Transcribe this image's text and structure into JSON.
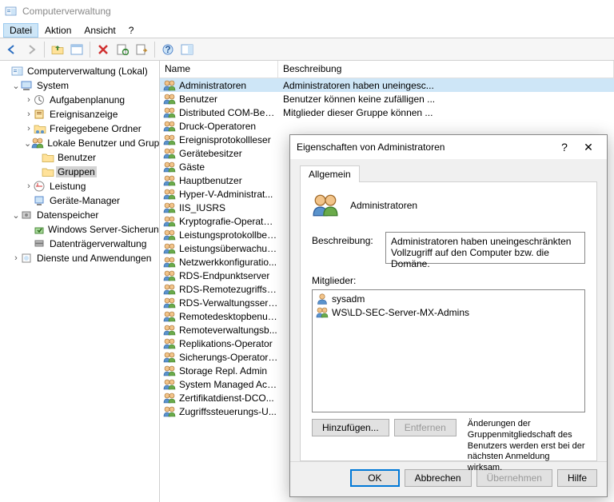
{
  "window": {
    "title": "Computerverwaltung"
  },
  "menu": {
    "datei": "Datei",
    "aktion": "Aktion",
    "ansicht": "Ansicht",
    "help": "?"
  },
  "tree": {
    "root": "Computerverwaltung (Lokal)",
    "system": "System",
    "aufgaben": "Aufgabenplanung",
    "ereignis": "Ereignisanzeige",
    "freigegeben": "Freigegebene Ordner",
    "lokaleBenutzer": "Lokale Benutzer und Gruppen",
    "benutzer": "Benutzer",
    "gruppen": "Gruppen",
    "leistung": "Leistung",
    "geraete": "Geräte-Manager",
    "datenspeicher": "Datenspeicher",
    "wsb": "Windows Server-Sicherung",
    "daten": "Datenträgerverwaltung",
    "dienste": "Dienste und Anwendungen"
  },
  "list": {
    "colName": "Name",
    "colDesc": "Beschreibung",
    "items": [
      {
        "n": "Administratoren",
        "d": "Administratoren haben uneingesc...",
        "sel": true
      },
      {
        "n": "Benutzer",
        "d": "Benutzer können keine zufälligen ..."
      },
      {
        "n": "Distributed COM-Ben...",
        "d": "Mitglieder dieser Gruppe können ..."
      },
      {
        "n": "Druck-Operatoren",
        "d": ""
      },
      {
        "n": "Ereignisprotokollleser",
        "d": ""
      },
      {
        "n": "Gerätebesitzer",
        "d": ""
      },
      {
        "n": "Gäste",
        "d": ""
      },
      {
        "n": "Hauptbenutzer",
        "d": ""
      },
      {
        "n": "Hyper-V-Administrat...",
        "d": ""
      },
      {
        "n": "IIS_IUSRS",
        "d": ""
      },
      {
        "n": "Kryptografie-Operator...",
        "d": ""
      },
      {
        "n": "Leistungsprotokollben...",
        "d": ""
      },
      {
        "n": "Leistungsüberwachun...",
        "d": ""
      },
      {
        "n": "Netzwerkkonfiguratio...",
        "d": ""
      },
      {
        "n": "RDS-Endpunktserver",
        "d": ""
      },
      {
        "n": "RDS-Remotezugriffsse...",
        "d": ""
      },
      {
        "n": "RDS-Verwaltungsserver",
        "d": ""
      },
      {
        "n": "Remotedesktopbenut...",
        "d": ""
      },
      {
        "n": "Remoteverwaltungsb...",
        "d": ""
      },
      {
        "n": "Replikations-Operator",
        "d": ""
      },
      {
        "n": "Sicherungs-Operatoren",
        "d": ""
      },
      {
        "n": "Storage Repl. Admin",
        "d": ""
      },
      {
        "n": "System Managed Acc...",
        "d": ""
      },
      {
        "n": "Zertifikatdienst-DCO...",
        "d": ""
      },
      {
        "n": "Zugriffssteuerungs-U...",
        "d": ""
      }
    ]
  },
  "dialog": {
    "title": "Eigenschaften von Administratoren",
    "tab": "Allgemein",
    "groupName": "Administratoren",
    "descLabel": "Beschreibung:",
    "descValue": "Administratoren haben uneingeschränkten Vollzugriff auf den Computer bzw. die Domäne.",
    "membersLabel": "Mitglieder:",
    "members": [
      {
        "n": "sysadm",
        "t": "user"
      },
      {
        "n": "WS\\LD-SEC-Server-MX-Admins",
        "t": "group"
      }
    ],
    "addBtn": "Hinzufügen...",
    "removeBtn": "Entfernen",
    "note": "Änderungen der Gruppenmitgliedschaft des Benutzers werden erst bei der nächsten Anmeldung wirksam.",
    "ok": "OK",
    "cancel": "Abbrechen",
    "apply": "Übernehmen",
    "help": "Hilfe"
  }
}
